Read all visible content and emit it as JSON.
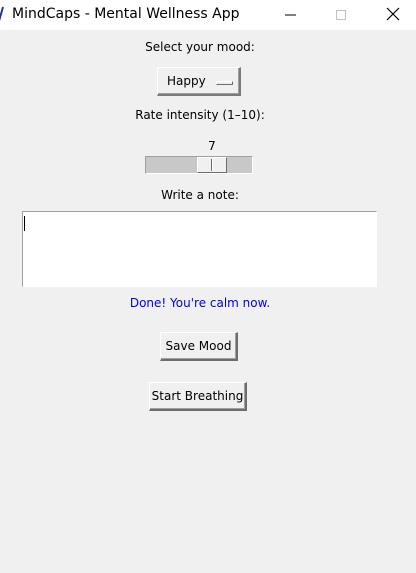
{
  "window": {
    "title": "MindCaps - Mental Wellness App",
    "icon": "feather-icon",
    "controls": {
      "minimize_icon": "minimize-icon",
      "maximize_icon": "maximize-icon",
      "close_icon": "close-icon"
    }
  },
  "mood": {
    "label": "Select your mood:",
    "selected": "Happy"
  },
  "intensity": {
    "label": "Rate intensity (1–10):",
    "value": "7",
    "min": 1,
    "max": 10,
    "current": 7
  },
  "note": {
    "label": "Write a note:",
    "value": ""
  },
  "status": {
    "message": "Done! You're calm now.",
    "color": "#0000ee"
  },
  "buttons": {
    "save_label": "Save Mood",
    "breathe_label": "Start Breathing"
  }
}
